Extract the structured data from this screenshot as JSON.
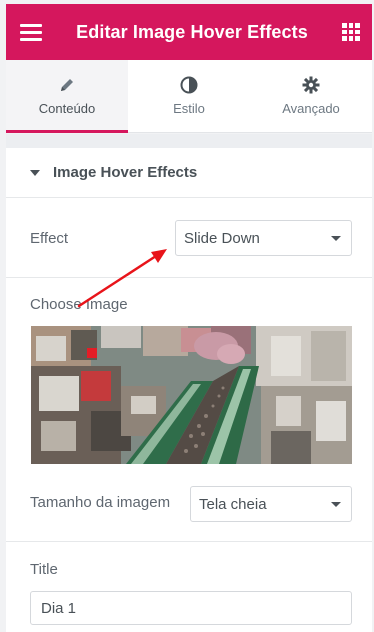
{
  "header": {
    "title": "Editar Image Hover Effects"
  },
  "tabs": [
    {
      "label": "Conteúdo",
      "icon": "pencil-icon",
      "active": true
    },
    {
      "label": "Estilo",
      "icon": "half-circle-icon",
      "active": false
    },
    {
      "label": "Avançado",
      "icon": "gear-icon",
      "active": false
    }
  ],
  "section": {
    "title": "Image Hover Effects"
  },
  "effect": {
    "label": "Effect",
    "value": "Slide Down"
  },
  "choose_image": {
    "label": "Choose Image"
  },
  "image_size": {
    "label": "Tamanho da imagem",
    "value": "Tela cheia"
  },
  "title_field": {
    "label": "Title",
    "value": "Dia 1"
  },
  "colors": {
    "accent": "#d5175d",
    "annotation_arrow": "#e8141a"
  }
}
